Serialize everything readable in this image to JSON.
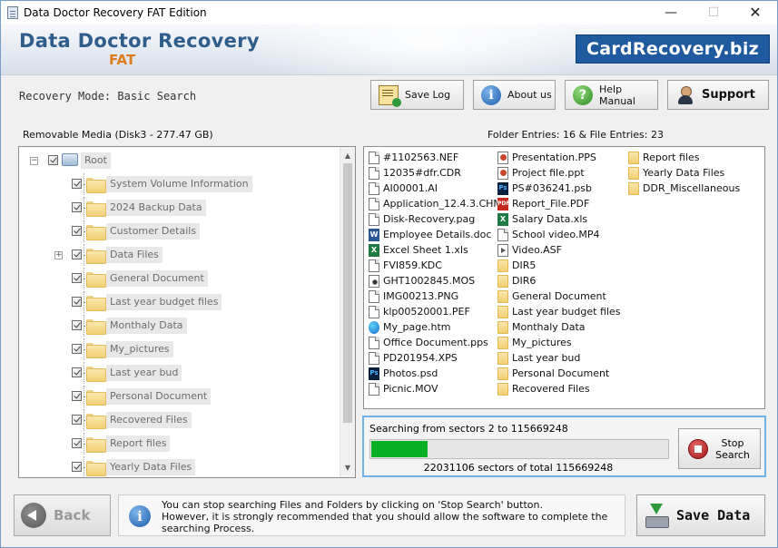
{
  "window": {
    "title": "Data Doctor Recovery FAT Edition",
    "minimize": "—",
    "maximize": "☐",
    "close": "✕"
  },
  "header": {
    "brand_title": "Data Doctor Recovery",
    "brand_subtitle": "FAT",
    "website": "CardRecovery.biz"
  },
  "toolbar": {
    "mode": "Recovery Mode: Basic Search",
    "save_log": "Save Log",
    "about_us": "About us",
    "help_manual": "Help Manual",
    "support": "Support",
    "about_icon_glyph": "i",
    "help_icon_glyph": "?"
  },
  "media": {
    "label": "Removable Media (Disk3 - 277.47 GB)",
    "entries": "Folder Entries: 16 & File Entries: 23"
  },
  "tree": {
    "root": "Root",
    "expand_glyph": "+",
    "collapse_glyph": "−",
    "items": [
      {
        "label": "System Volume Information",
        "expandable": false
      },
      {
        "label": "2024 Backup Data",
        "expandable": false
      },
      {
        "label": "Customer Details",
        "expandable": false
      },
      {
        "label": "Data Files",
        "expandable": true
      },
      {
        "label": "General Document",
        "expandable": false
      },
      {
        "label": "Last year budget files",
        "expandable": false
      },
      {
        "label": "Monthaly Data",
        "expandable": false
      },
      {
        "label": "My_pictures",
        "expandable": false
      },
      {
        "label": "Last year bud",
        "expandable": false
      },
      {
        "label": "Personal Document",
        "expandable": false
      },
      {
        "label": "Recovered Files",
        "expandable": false
      },
      {
        "label": "Report files",
        "expandable": false
      },
      {
        "label": "Yearly Data Files",
        "expandable": false
      }
    ]
  },
  "files": {
    "columns": [
      [
        {
          "name": "#1102563.NEF",
          "icon": "document-icon"
        },
        {
          "name": "12035#dfr.CDR",
          "icon": "document-icon"
        },
        {
          "name": "AI00001.AI",
          "icon": "document-icon"
        },
        {
          "name": "Application_12.4.3.CHM",
          "icon": "chm-icon"
        },
        {
          "name": "Disk-Recovery.pag",
          "icon": "document-icon"
        },
        {
          "name": "Employee Details.doc",
          "icon": "word-icon"
        },
        {
          "name": "Excel Sheet 1.xls",
          "icon": "excel-icon"
        },
        {
          "name": "FVI859.KDC",
          "icon": "document-icon"
        },
        {
          "name": "GHT1002845.MOS",
          "icon": "camera-icon"
        },
        {
          "name": "IMG00213.PNG",
          "icon": "document-icon"
        },
        {
          "name": "klp00520001.PEF",
          "icon": "document-icon"
        },
        {
          "name": "My_page.htm",
          "icon": "web-icon"
        },
        {
          "name": "Office Document.pps",
          "icon": "document-icon"
        },
        {
          "name": "PD201954.XPS",
          "icon": "document-icon"
        },
        {
          "name": "Photos.psd",
          "icon": "psd-icon"
        },
        {
          "name": "Picnic.MOV",
          "icon": "document-icon"
        }
      ],
      [
        {
          "name": "Presentation.PPS",
          "icon": "powerpoint-icon"
        },
        {
          "name": "Project file.ppt",
          "icon": "powerpoint-icon"
        },
        {
          "name": "PS#036241.psb",
          "icon": "psd-icon"
        },
        {
          "name": "Report_File.PDF",
          "icon": "pdf-icon"
        },
        {
          "name": "Salary Data.xls",
          "icon": "excel-icon"
        },
        {
          "name": "School video.MP4",
          "icon": "document-icon"
        },
        {
          "name": "Video.ASF",
          "icon": "media-icon"
        },
        {
          "name": "DIR5",
          "icon": "folder-icon"
        },
        {
          "name": "DIR6",
          "icon": "folder-icon"
        },
        {
          "name": "General Document",
          "icon": "folder-icon"
        },
        {
          "name": "Last year budget files",
          "icon": "folder-icon"
        },
        {
          "name": "Monthaly Data",
          "icon": "folder-icon"
        },
        {
          "name": "My_pictures",
          "icon": "folder-icon"
        },
        {
          "name": "Last year bud",
          "icon": "folder-icon"
        },
        {
          "name": "Personal Document",
          "icon": "folder-icon"
        },
        {
          "name": "Recovered Files",
          "icon": "folder-icon"
        }
      ],
      [
        {
          "name": "Report files",
          "icon": "folder-icon"
        },
        {
          "name": "Yearly Data Files",
          "icon": "folder-icon"
        },
        {
          "name": "DDR_Miscellaneous",
          "icon": "folder-icon"
        }
      ]
    ]
  },
  "search": {
    "status": "Searching from sectors    2 to 115669248",
    "sectors": "22031106   sectors  of  total  115669248",
    "progress_fraction": 0.19,
    "stop_label": "Stop Search"
  },
  "footer": {
    "back_label": "Back",
    "notice_icon_glyph": "i",
    "notice": "You can stop searching Files and Folders by clicking on 'Stop Search' button.\nHowever, it is strongly recommended that you should allow the software to complete the searching Process.",
    "save_data_label": "Save Data"
  },
  "colors": {
    "brand_blue": "#2f5d8c",
    "brand_orange": "#e07b1e",
    "website_badge": "#1f5a9f",
    "progress_green": "#06b025",
    "search_box_border": "#6fb3e6"
  }
}
